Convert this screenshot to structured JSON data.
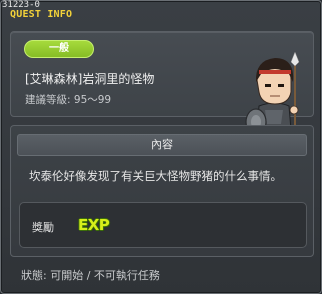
{
  "window": {
    "version": "31223-0",
    "title": "QUEST INFO"
  },
  "quest": {
    "category_badge": "一般",
    "name": "[艾琳森林]岩洞里的怪物",
    "level_label": "建議等級",
    "level_value": "95～99",
    "npc_icon": "spear-warrior-npc-portrait"
  },
  "content": {
    "header": "內容",
    "description": "坎泰伦好像发现了有关巨大怪物野猪的什么事情。"
  },
  "reward": {
    "label": "獎勵",
    "item": "EXP",
    "item_icon": "exp-icon"
  },
  "status": {
    "label": "狀態",
    "value": "可開始 / 不可執行任務"
  },
  "colors": {
    "title": "#f3d23a",
    "badge": "#97cb2f",
    "exp": "#d7ef1a"
  }
}
